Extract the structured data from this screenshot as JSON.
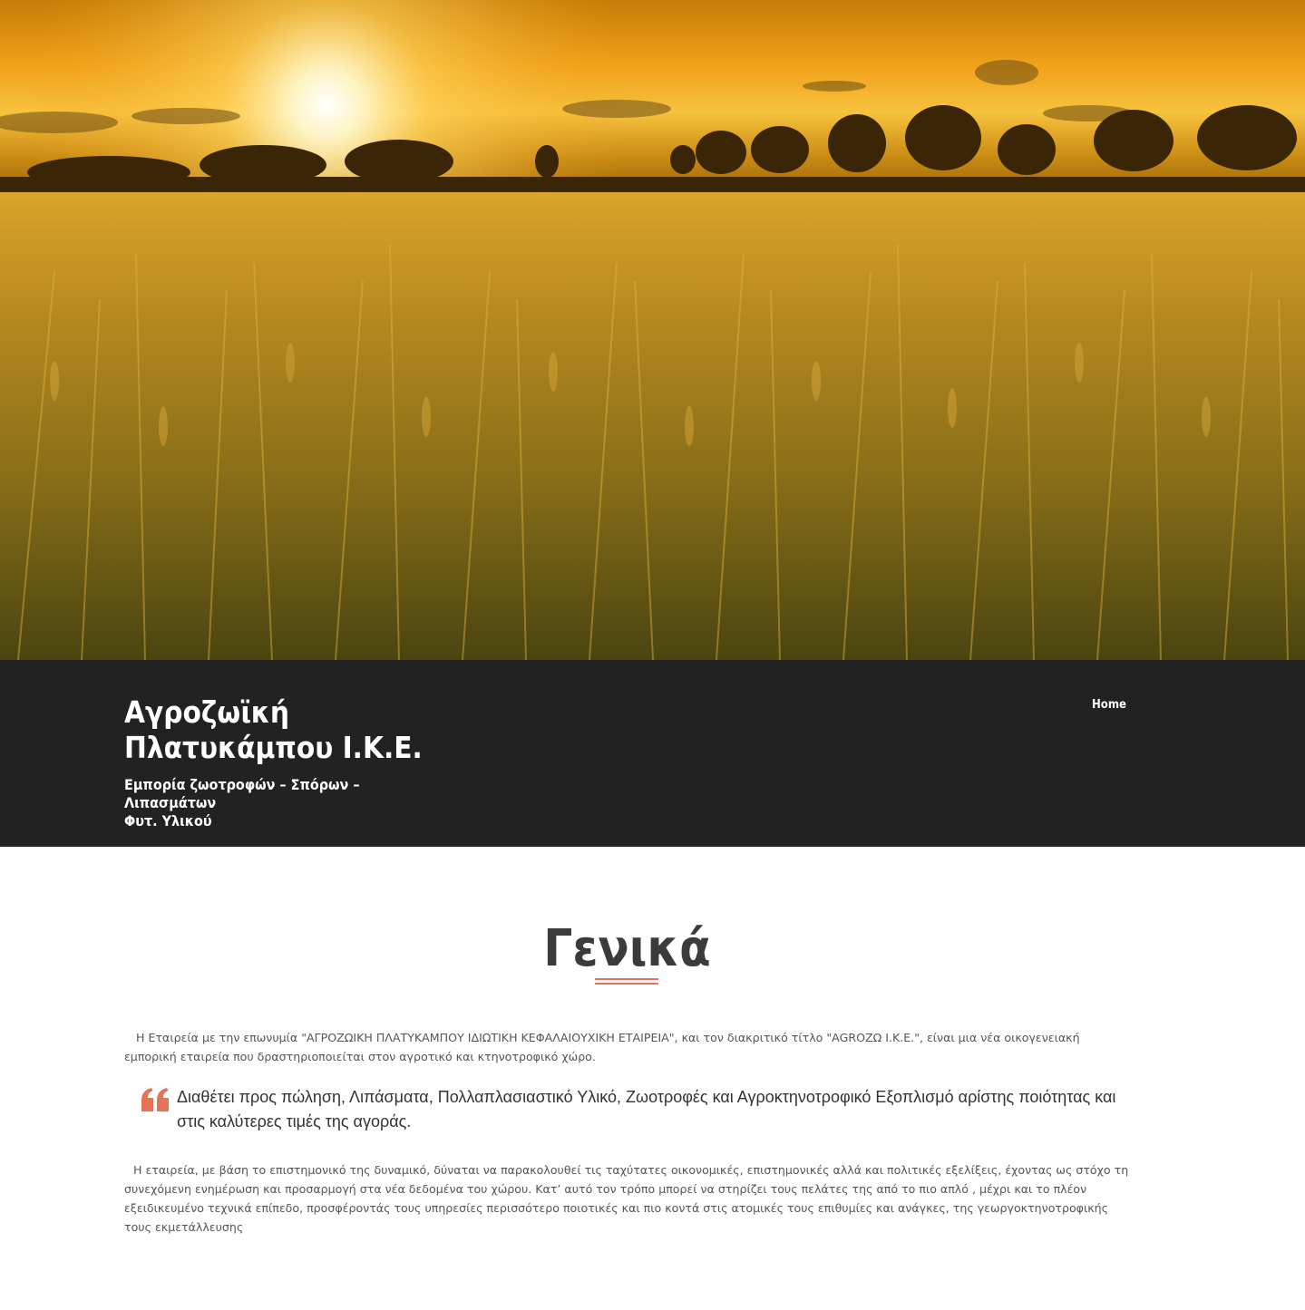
{
  "header": {
    "site_title_line1": "Αγροζωϊκή",
    "site_title_line2": "Πλατυκάμπου Ι.Κ.Ε.",
    "site_description_line1": "Εμπορία ζωοτροφών – Σπόρων – Λιπασμάτων",
    "site_description_line2": "Φυτ. Υλικού"
  },
  "nav": {
    "items": [
      {
        "label": "Home"
      }
    ]
  },
  "main": {
    "heading": "Γενικά",
    "intro": "Η Εταιρεία με την επωνυμία \"ΑΓΡΟΖΩΙΚΗ ΠΛΑΤΥΚΑΜΠΟΥ ΙΔΙΩΤΙΚΗ ΚΕΦΑΛΑΙΟΥΧΙΚΗ ΕΤΑΙΡΕΙΑ\", και τον διακριτικό τίτλο \"AGROZΩ I.K.E.\", είναι μια νέα οικογενειακή εμπορική εταιρεία που δραστηριοποιείται στον αγροτικό και κτηνοτροφικό χώρο.",
    "quote": "Διαθέτει προς πώληση, Λιπάσματα, Πολλαπλασιαστικό Υλικό, Ζωοτροφές και   Αγροκτηνοτροφικό Εξοπλισμό αρίστης ποιότητας και στις καλύτερες τιμές της αγοράς.",
    "body": "Η εταιρεία, με βάση  το επιστημονικό της δυναμικό, δύναται να παρακολουθεί τις ταχύτατες οικονομικές, επιστημονικές αλλά και πολιτικές εξελίξεις, έχοντας ως στόχο τη συνεχόμενη ενημέρωση και προσαρμογή στα νέα δεδομένα του χώρου. Κατ’ αυτό τον τρόπο μπορεί να στηρίζει τους πελάτες της από το πιο απλό , μέχρι και το πλέον εξειδικευμένο τεχνικά επίπεδο, προσφέροντάς τους υπηρεσίες περισσότερο ποιοτικές και πιο κοντά στις ατομικές τους επιθυμίες και ανάγκες, της γεωργοκτηνοτροφικής τους εκμετάλλευσης"
  },
  "colors": {
    "header_bg": "#222222",
    "accent": "#e57358",
    "heading_text": "#3b3b3b",
    "body_text": "#555555"
  },
  "icons": [
    "quote-icon"
  ]
}
